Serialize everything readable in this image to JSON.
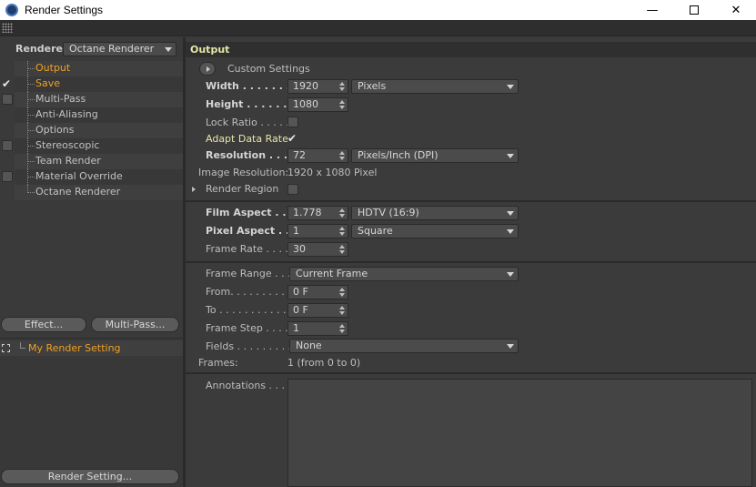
{
  "window": {
    "title": "Render Settings",
    "min_glyph": "—",
    "close_glyph": "✕"
  },
  "left": {
    "renderer_label": "Renderer",
    "renderer_value": "Octane Renderer",
    "tree": [
      {
        "label": "Output",
        "checkbox": "none",
        "active": true
      },
      {
        "label": "Save",
        "checkbox": "checked",
        "active": true
      },
      {
        "label": "Multi-Pass",
        "checkbox": "unchecked",
        "active": false
      },
      {
        "label": "Anti-Aliasing",
        "checkbox": "none",
        "active": false
      },
      {
        "label": "Options",
        "checkbox": "none",
        "active": false
      },
      {
        "label": "Stereoscopic",
        "checkbox": "unchecked",
        "active": false
      },
      {
        "label": "Team Render",
        "checkbox": "none",
        "active": false
      },
      {
        "label": "Material Override",
        "checkbox": "unchecked",
        "active": false
      },
      {
        "label": "Octane Renderer",
        "checkbox": "none",
        "active": false
      }
    ],
    "check_glyph": "✔",
    "effect_button": "Effect...",
    "multipass_button": "Multi-Pass...",
    "setting_name": "My Render Setting",
    "render_setting_button": "Render Setting..."
  },
  "output": {
    "section_title": "Output",
    "custom_settings": "Custom Settings",
    "width_label": "Width . . . . . . . . .",
    "width_value": "1920",
    "width_unit": "Pixels",
    "height_label": "Height . . . . . . . .",
    "height_value": "1080",
    "lock_ratio_label": "Lock Ratio . . . . .",
    "lock_ratio_checked": false,
    "adapt_data_rate_label": "Adapt Data Rate",
    "adapt_data_rate_checked": true,
    "check_glyph": "✔",
    "resolution_label": "Resolution . . . . .",
    "resolution_value": "72",
    "resolution_unit": "Pixels/Inch (DPI)",
    "image_resolution_label": "Image Resolution:",
    "image_resolution_value": "1920 x 1080 Pixel",
    "render_region_label": "Render Region",
    "render_region_checked": false,
    "film_aspect_label": "Film Aspect . . . .",
    "film_aspect_value": "1.778",
    "film_aspect_preset": "HDTV (16:9)",
    "pixel_aspect_label": "Pixel Aspect . . .",
    "pixel_aspect_value": "1",
    "pixel_aspect_preset": "Square",
    "frame_rate_label": "Frame Rate . . . .",
    "frame_rate_value": "30",
    "frame_range_label": "Frame Range . . .",
    "frame_range_value": "Current Frame",
    "from_label": "From. . . . . . . . . .",
    "from_value": "0 F",
    "to_label": "To . . . . . . . . . . . .",
    "to_value": "0 F",
    "frame_step_label": "Frame Step . . . .",
    "frame_step_value": "1",
    "fields_label": "Fields . . . . . . . . .",
    "fields_value": "None",
    "frames_label": "Frames:",
    "frames_value": "1 (from 0 to 0)",
    "annotations_label": "Annotations . . . ."
  }
}
